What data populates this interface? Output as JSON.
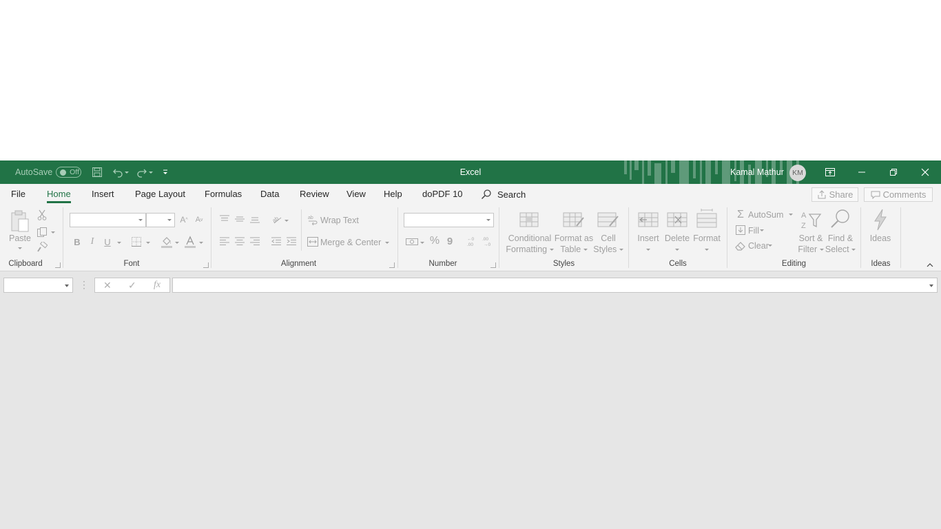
{
  "titlebar": {
    "autosave_label": "AutoSave",
    "autosave_state": "Off",
    "app_title": "Excel",
    "user_name": "Kamal Mathur",
    "user_initials": "KM"
  },
  "tabs": [
    "File",
    "Home",
    "Insert",
    "Page Layout",
    "Formulas",
    "Data",
    "Review",
    "View",
    "Help",
    "doPDF 10"
  ],
  "active_tab": "Home",
  "search_label": "Search",
  "share_label": "Share",
  "comments_label": "Comments",
  "ribbon": {
    "clipboard": {
      "group": "Clipboard",
      "paste": "Paste"
    },
    "font": {
      "group": "Font",
      "bold": "B",
      "italic": "I",
      "underline": "U",
      "font_name": "",
      "font_size": ""
    },
    "alignment": {
      "group": "Alignment",
      "wrap_text": "Wrap Text",
      "merge_center": "Merge & Center"
    },
    "number": {
      "group": "Number",
      "format": "",
      "percent": "%",
      "comma": "9"
    },
    "styles": {
      "group": "Styles",
      "cond_1": "Conditional",
      "cond_2": "Formatting",
      "fat_1": "Format as",
      "fat_2": "Table",
      "cs_1": "Cell",
      "cs_2": "Styles"
    },
    "cells": {
      "group": "Cells",
      "insert": "Insert",
      "delete": "Delete",
      "format": "Format"
    },
    "editing": {
      "group": "Editing",
      "autosum": "AutoSum",
      "fill": "Fill",
      "clear": "Clear",
      "sort_1": "Sort &",
      "sort_2": "Filter",
      "find_1": "Find &",
      "find_2": "Select"
    },
    "ideas": {
      "group": "Ideas",
      "ideas": "Ideas"
    }
  },
  "formula_bar": {
    "name_box": "",
    "formula": "",
    "fx": "fx"
  },
  "colors": {
    "excel_green": "#217346",
    "ribbon_bg": "#f3f3f3",
    "workspace_bg": "#e6e6e6"
  }
}
